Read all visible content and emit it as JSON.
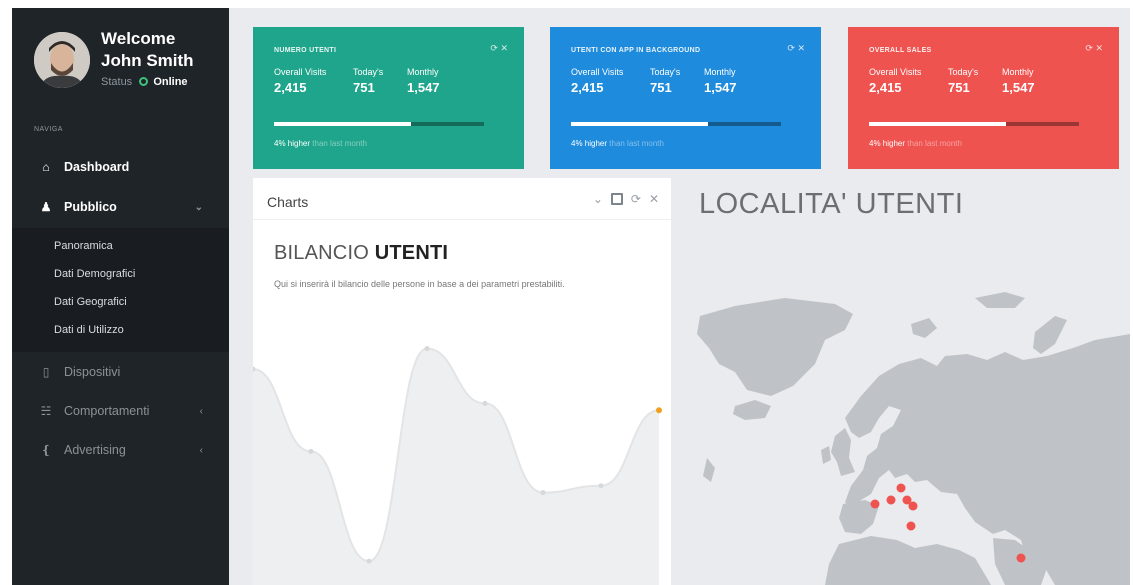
{
  "user": {
    "welcome": "Welcome",
    "name": "John Smith",
    "status_label": "Status",
    "status_value": "Online"
  },
  "nav": {
    "heading": "NAVIGA",
    "items": [
      {
        "label": "Dashboard",
        "icon": "home-icon"
      },
      {
        "label": "Pubblico",
        "icon": "users-icon"
      },
      {
        "label": "Dispositivi",
        "icon": "mobile-icon"
      },
      {
        "label": "Comportamenti",
        "icon": "sitemap-icon"
      },
      {
        "label": "Advertising",
        "icon": "megaphone-icon"
      }
    ],
    "submenu": [
      "Panoramica",
      "Dati Demografici",
      "Dati Geografici",
      "Dati di Utilizzo"
    ]
  },
  "cards": [
    {
      "title": "NUMERO UTENTI",
      "color": "#1fa58b",
      "metrics": [
        {
          "label": "Overall Visits",
          "value": "2,415"
        },
        {
          "label": "Today's",
          "value": "751"
        },
        {
          "label": "Monthly",
          "value": "1,547"
        }
      ],
      "progress": 0.65,
      "footer_strong": "4% higher",
      "footer_muted": "than last month"
    },
    {
      "title": "UTENTI CON APP IN BACKGROUND",
      "color": "#1e8bdc",
      "metrics": [
        {
          "label": "Overall Visits",
          "value": "2,415"
        },
        {
          "label": "Today's",
          "value": "751"
        },
        {
          "label": "Monthly",
          "value": "1,547"
        }
      ],
      "progress": 0.65,
      "footer_strong": "4% higher",
      "footer_muted": "than last month"
    },
    {
      "title": "OVERALL SALES",
      "color": "#ef5350",
      "metrics": [
        {
          "label": "Overall Visits",
          "value": "2,415"
        },
        {
          "label": "Today's",
          "value": "751"
        },
        {
          "label": "Monthly",
          "value": "1,547"
        }
      ],
      "progress": 0.65,
      "footer_strong": "4% higher",
      "footer_muted": "than last month"
    }
  ],
  "charts_panel": {
    "title": "Charts",
    "heading_light": "BILANCIO",
    "heading_bold": "UTENTI",
    "description": "Qui si inserirà il bilancio delle persone in base a dei parametri prestabiliti."
  },
  "map_panel": {
    "title": "LOCALITA' UTENTI",
    "marker_color": "#ef5350"
  },
  "chart_data": {
    "type": "area",
    "x": [
      0,
      1,
      2,
      3,
      4,
      5,
      6,
      7
    ],
    "values": [
      58,
      34,
      2,
      64,
      48,
      22,
      24,
      46
    ],
    "ylim": [
      0,
      70
    ]
  }
}
